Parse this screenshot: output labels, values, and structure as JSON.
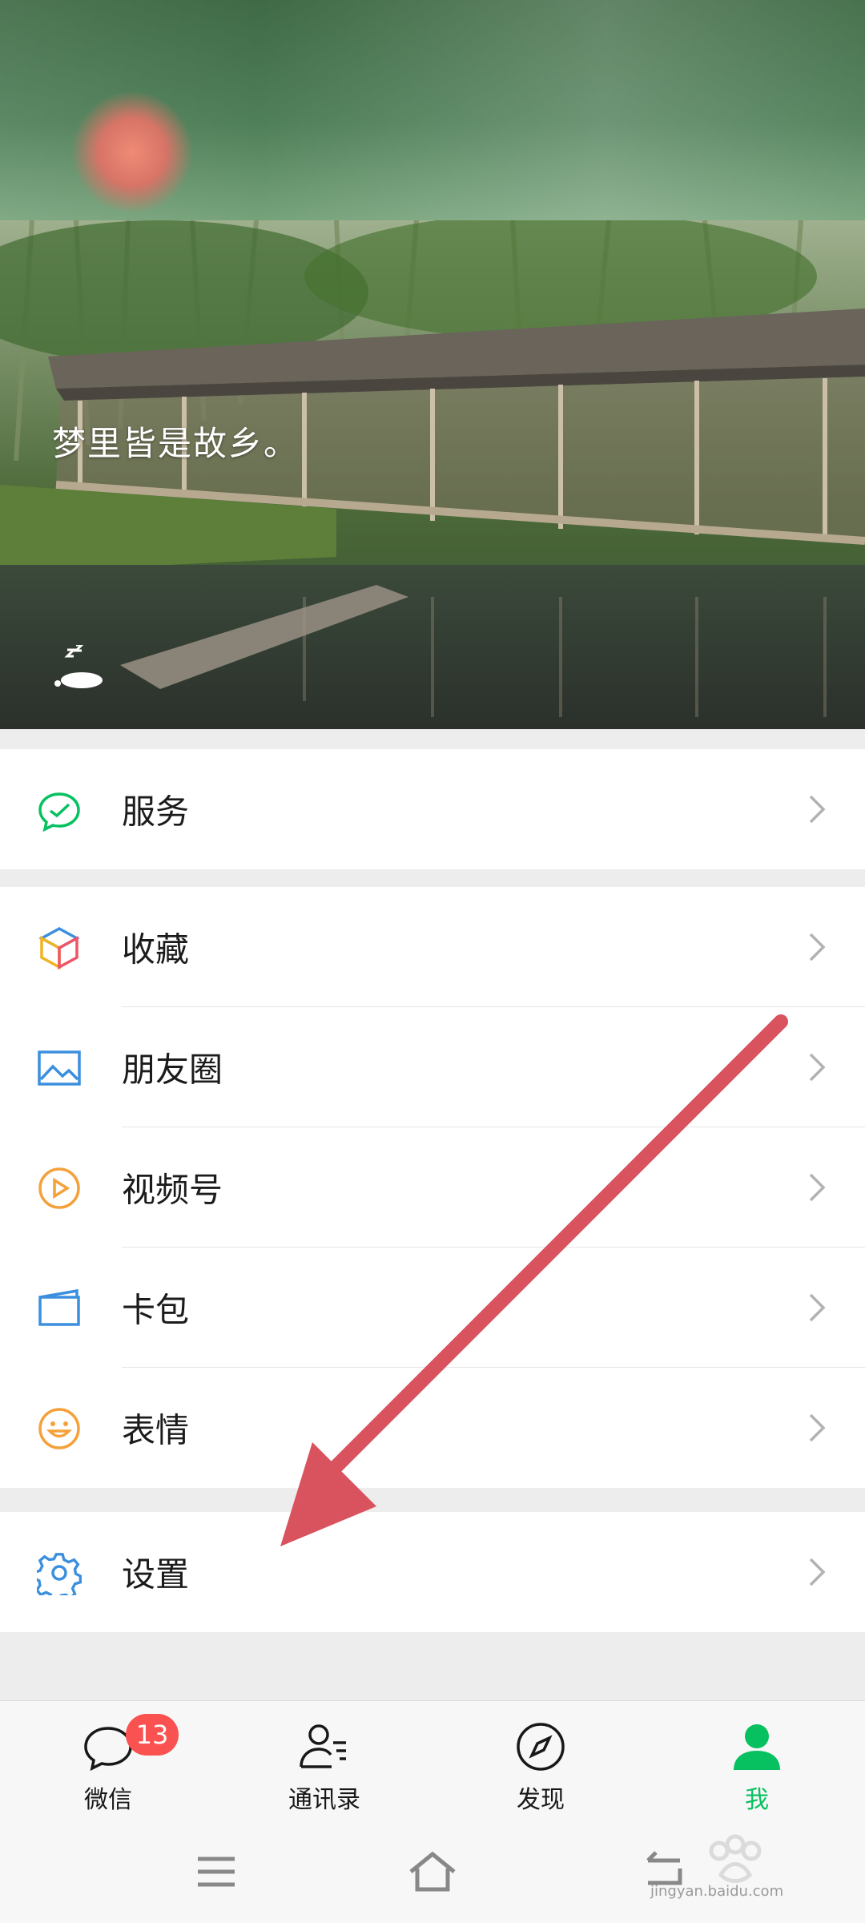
{
  "cover": {
    "text": "梦里皆是故乡。"
  },
  "menu": {
    "group1": [
      {
        "label": "服务",
        "icon": "service-icon"
      }
    ],
    "group2": [
      {
        "label": "收藏",
        "icon": "favorites-cube-icon"
      },
      {
        "label": "朋友圈",
        "icon": "moments-photo-icon"
      },
      {
        "label": "视频号",
        "icon": "channels-play-icon"
      },
      {
        "label": "卡包",
        "icon": "card-wallet-icon"
      },
      {
        "label": "表情",
        "icon": "sticker-smile-icon"
      }
    ],
    "group3": [
      {
        "label": "设置",
        "icon": "settings-gear-icon"
      }
    ]
  },
  "tabbar": {
    "tabs": [
      {
        "label": "微信",
        "icon": "chat-bubble-icon",
        "badge": "13"
      },
      {
        "label": "通讯录",
        "icon": "contacts-icon"
      },
      {
        "label": "发现",
        "icon": "compass-icon"
      },
      {
        "label": "我",
        "icon": "person-icon",
        "active": true
      }
    ]
  },
  "watermark": {
    "text": "jingyan.baidu.com"
  },
  "colors": {
    "accent": "#07c160",
    "badge": "#fa5151",
    "arrow": "#d9535f"
  }
}
